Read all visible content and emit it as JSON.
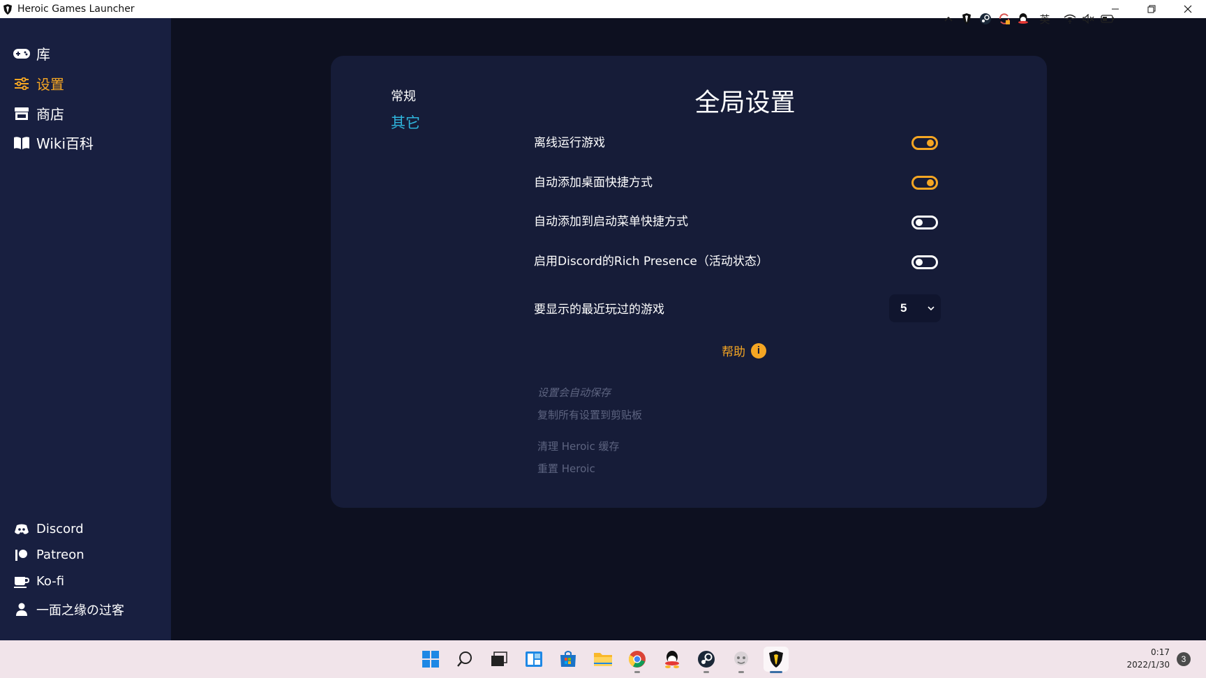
{
  "window": {
    "title": "Heroic Games Launcher"
  },
  "sidebar": {
    "nav": [
      {
        "label": "库",
        "icon": "gamepad-icon"
      },
      {
        "label": "设置",
        "icon": "sliders-icon",
        "active": true
      },
      {
        "label": "商店",
        "icon": "store-icon"
      },
      {
        "label": "Wiki百科",
        "icon": "book-icon"
      }
    ],
    "links": [
      {
        "label": "Discord",
        "icon": "discord-icon"
      },
      {
        "label": "Patreon",
        "icon": "patreon-icon"
      },
      {
        "label": "Ko-fi",
        "icon": "coffee-cup-icon"
      },
      {
        "label": "一面之缘の过客",
        "icon": "user-icon"
      }
    ]
  },
  "settings": {
    "tabs": {
      "general": "常规",
      "other": "其它"
    },
    "title": "全局设置",
    "options": [
      {
        "label": "离线运行游戏",
        "enabled": true
      },
      {
        "label": "自动添加桌面快捷方式",
        "enabled": true
      },
      {
        "label": "自动添加到启动菜单快捷方式",
        "enabled": false
      },
      {
        "label": "启用Discord的Rich Presence（活动状态）",
        "enabled": false
      }
    ],
    "recent_games": {
      "label": "要显示的最近玩过的游戏",
      "value": "5"
    },
    "help_label": "帮助",
    "autosave_note": "设置会自动保存",
    "copy_settings": "复制所有设置到剪贴板",
    "clear_cache": "清理 Heroic 缓存",
    "reset": "重置 Heroic"
  },
  "taskbar": {
    "apps": [
      "windows-start-icon",
      "search-icon",
      "task-view-icon",
      "widgets-icon",
      "microsoft-store-icon",
      "file-explorer-icon",
      "chrome-icon",
      "qq-icon",
      "steam-icon",
      "app-icon",
      "heroic-icon"
    ],
    "ime": "英",
    "clock_time": "0:17",
    "clock_date": "2022/1/30",
    "notifications": "3"
  },
  "colors": {
    "accent": "#f5a623",
    "link": "#2fb5dc",
    "sidebar": "#181f40",
    "panel": "#161c38",
    "background": "#0d1020"
  }
}
